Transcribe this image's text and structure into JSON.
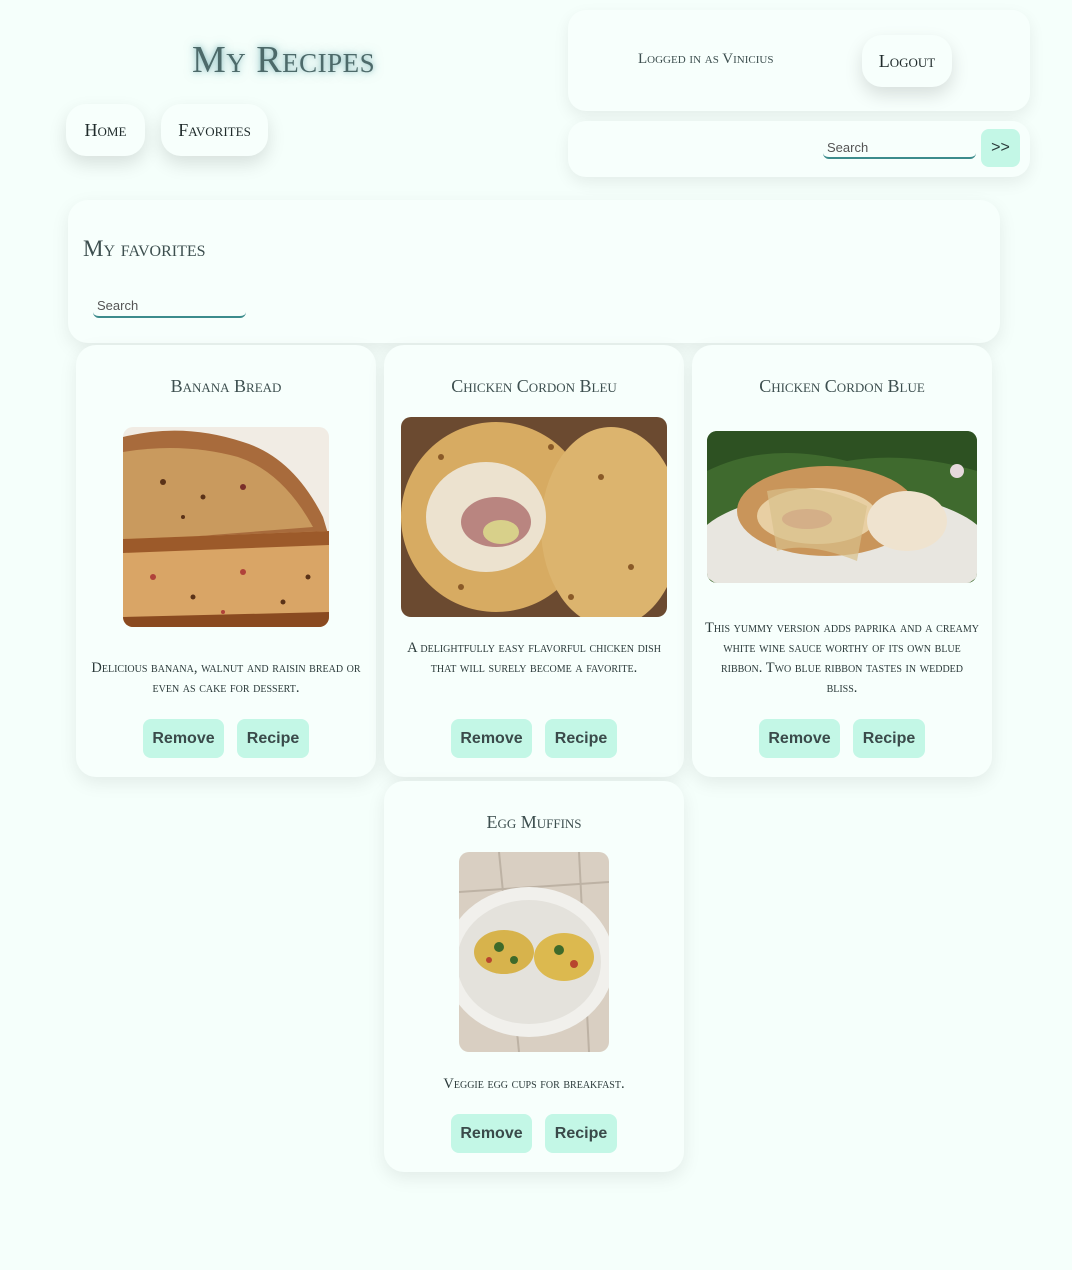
{
  "header": {
    "site_title": "My Recipes",
    "nav": [
      {
        "label": "Home"
      },
      {
        "label": "Favorites"
      }
    ]
  },
  "user": {
    "logged_in_text": "Logged in as Vinicius",
    "logout_label": "Logout"
  },
  "top_search": {
    "placeholder": "Search",
    "go_label": ">>"
  },
  "favorites": {
    "title": "My favorites",
    "search_placeholder": "Search"
  },
  "cards": [
    {
      "title": "Banana Bread",
      "description": "Delicious banana, walnut and raisin bread or even as cake for dessert.",
      "image_icon": "banana-bread-photo",
      "remove_label": "Remove",
      "recipe_label": "Recipe"
    },
    {
      "title": "Chicken Cordon Bleu",
      "description": "A delightfully easy flavorful chicken dish that will surely become a favorite.",
      "image_icon": "chicken-cordon-bleu-photo",
      "remove_label": "Remove",
      "recipe_label": "Recipe"
    },
    {
      "title": "Chicken Cordon Blue",
      "description": "This yummy version adds paprika and a creamy white wine sauce worthy of its own blue ribbon. Two blue ribbon tastes in wedded bliss.",
      "image_icon": "chicken-cordon-blue-photo",
      "remove_label": "Remove",
      "recipe_label": "Recipe"
    },
    {
      "title": "Egg Muffins",
      "description": "Veggie egg cups for breakfast.",
      "image_icon": "egg-muffins-photo",
      "remove_label": "Remove",
      "recipe_label": "Recipe"
    }
  ],
  "colors": {
    "background": "#f5fffb",
    "panel": "#f7fffc",
    "button_accent": "#c3f7e6",
    "input_underline": "#3c8c8c",
    "title_glow": "#4d6a6a"
  }
}
